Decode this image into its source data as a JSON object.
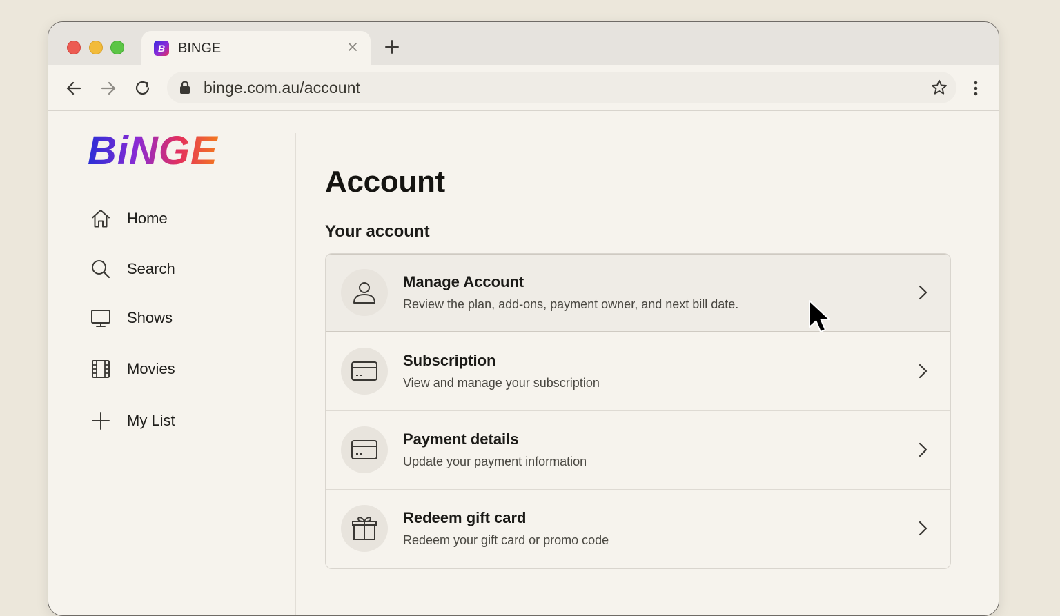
{
  "browser": {
    "tab": {
      "title": "BINGE",
      "favicon_letter": "B"
    },
    "address": {
      "url": "binge.com.au/account"
    }
  },
  "brand": {
    "logo_text": "BiNGE",
    "gradient": [
      "#2a2fd6",
      "#8b2bd3",
      "#e4305c",
      "#f37a1f"
    ]
  },
  "sidebar": {
    "items": [
      {
        "label": "Home",
        "icon": "home-icon"
      },
      {
        "label": "Search",
        "icon": "search-icon"
      },
      {
        "label": "Shows",
        "icon": "tv-icon"
      },
      {
        "label": "Movies",
        "icon": "film-icon"
      },
      {
        "label": "My List",
        "icon": "plus-icon"
      }
    ]
  },
  "main": {
    "title": "Account",
    "section_title": "Your account",
    "rows": [
      {
        "title": "Manage Account",
        "subtitle": "Review the plan, add-ons, payment owner, and next bill date.",
        "icon": "user-icon",
        "state": "hover"
      },
      {
        "title": "Subscription",
        "subtitle": "View and manage your subscription",
        "icon": "card-icon"
      },
      {
        "title": "Payment details",
        "subtitle": "Update your payment information",
        "icon": "card-icon"
      },
      {
        "title": "Redeem gift card",
        "subtitle": "Redeem your gift card or promo code",
        "icon": "gift-icon"
      }
    ]
  }
}
